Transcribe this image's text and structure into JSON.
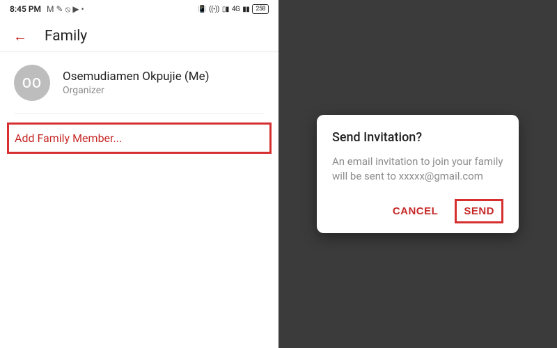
{
  "status_bar": {
    "time": "8:45 PM",
    "left_icons": [
      "gmail-icon",
      "wrench-icon",
      "do-not-disturb-icon",
      "youtube-icon",
      "more-dot-icon"
    ],
    "right_text": "4G",
    "battery": "258",
    "right_icons": [
      "vibrate-icon",
      "hotspot-icon",
      "signal-icon",
      "data-icon",
      "signal-strength-icon"
    ]
  },
  "header": {
    "title": "Family",
    "back_icon": "←"
  },
  "member": {
    "initials": "OO",
    "name": "Osemudiamen Okpujie (Me)",
    "role": "Organizer"
  },
  "add_member_label": "Add Family Member...",
  "dialog": {
    "title": "Send Invitation?",
    "body": "An email invitation to join your family will be sent to xxxxx@gmail.com",
    "cancel": "CANCEL",
    "send": "SEND"
  },
  "colors": {
    "accent": "#c62828",
    "highlight_border": "#d62f2f",
    "muted_text": "#8a8a8a",
    "dialog_overlay": "#3b3b3b"
  }
}
